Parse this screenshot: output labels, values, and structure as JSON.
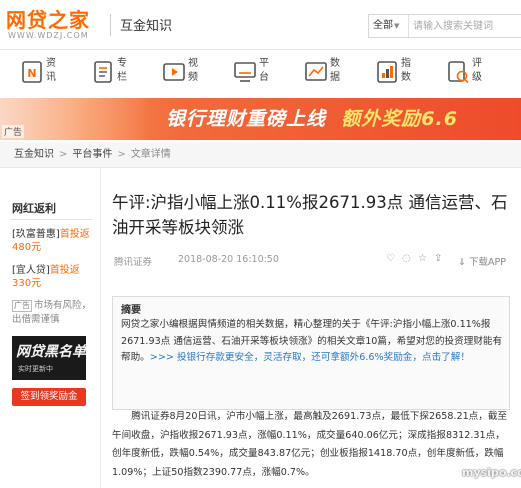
{
  "header": {
    "logo_text_1": "网贷",
    "logo_text_2": "之家",
    "logo_url": "WWW.WDZJ.COM",
    "section_title": "互金知识",
    "search_scope": "全部",
    "search_placeholder": "请输入搜索关键词"
  },
  "nav": {
    "items": [
      {
        "label": "资讯",
        "icon": "news-icon"
      },
      {
        "label": "专栏",
        "icon": "column-icon"
      },
      {
        "label": "视频",
        "icon": "video-icon"
      },
      {
        "label": "平台",
        "icon": "platform-icon"
      },
      {
        "label": "数据",
        "icon": "data-chart-icon"
      },
      {
        "label": "指数",
        "icon": "index-icon"
      },
      {
        "label": "评级",
        "icon": "rating-icon"
      }
    ]
  },
  "banner": {
    "text_1": "银行理财重磅上线",
    "text_2": "额外奖励6.6",
    "ad_label": "广告"
  },
  "breadcrumb": {
    "items": [
      "互金知识",
      "平台事件",
      "文章详情"
    ]
  },
  "sidebar": {
    "title": "网红返利",
    "entries": [
      {
        "name": "[玖富普惠]",
        "promo": "首投返480元"
      },
      {
        "name": "[宜人贷]",
        "promo": "首投返330元"
      }
    ],
    "notice_ad": "广告",
    "notice": "市场有风险，出借需谨慎",
    "image_text": "网贷黑名单",
    "image_subtext": "实时更新中",
    "button": "签到领奖励金"
  },
  "article": {
    "title": "午评:沪指小幅上涨0.11%报2671.93点 通信运营、石油开采等板块领涨",
    "source": "腾讯证券",
    "time": "2018-08-20 16:10:50",
    "download": "下载APP",
    "summary_label": "摘要",
    "summary_text": "网贷之家小编根据舆情频道的相关数据，精心整理的关于《午评:沪指小幅上涨0.11%报2671.93点 通信运营、石油开采等板块领涨》的相关文章10篇，希望对您的投资理财能有帮助。",
    "summary_link": ">>> 投银行存款更安全，灵活存取，还可拿额外6.6%奖励金，点击了解！",
    "body": "腾讯证券8月20日讯，沪市小幅上涨，最高触及2691.73点，最低下探2658.21点，截至午间收盘，沪指收报2671.93点，涨幅0.11%，成交量640.06亿元；深成指报8312.31点，创年度新低，跌幅0.54%，成交量843.87亿元；创业板指报1418.70点，创年度新低，跌幅1.09%；上证50指数2390.77点，涨幅0.7%。"
  },
  "watermark": "mysipo.com",
  "colors": {
    "brand_orange": "#ff6a00",
    "banner_red": "#ee4b2b",
    "link_blue": "#2a78c8",
    "button_red": "#e8381e"
  }
}
